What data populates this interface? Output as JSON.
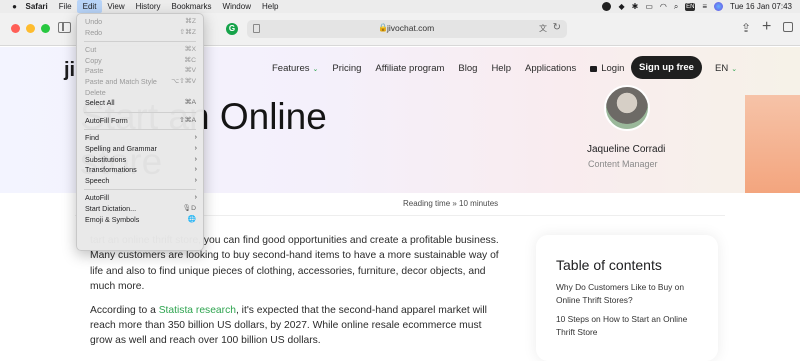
{
  "menubar": {
    "items": [
      "Safari",
      "File",
      "Edit",
      "View",
      "History",
      "Bookmarks",
      "Window",
      "Help"
    ],
    "datetime": "Tue 16 Jan  07:43",
    "badge": "EN"
  },
  "toolbar": {
    "url": "jivochat.com"
  },
  "site": {
    "logo": "ji",
    "nav": [
      "Features",
      "Pricing",
      "Affiliate program",
      "Blog",
      "Help",
      "Applications",
      "Login"
    ],
    "signup_label": "Sign up free",
    "lang": "EN",
    "title_line1": "Start an Online",
    "title_line2": "store",
    "author_name": "Jaqueline Corradi",
    "author_role": "Content Manager",
    "reading_time": "Reading time » 10 minutes",
    "para1": "tart an online thrift store, you can find good opportunities and create a profitable business. Many customers are looking to buy second-hand items to have a more sustainable way of life and also to find unique pieces of clothing, accessories, furniture, decor objects, and much more.",
    "para2_pre": "According to a ",
    "para2_link": "Statista research",
    "para2_post": ", it's expected that the second-hand apparel market will reach more than 350 billion US dollars, by 2027. While online resale ecommerce must grow as well and reach over 100 billion US dollars.",
    "toc_title": "Table of contents",
    "toc_items": [
      "Why Do Customers Like to Buy on Online Thrift Stores?",
      "10 Steps on How to Start an Online Thrift Store"
    ]
  },
  "edit_menu": [
    {
      "label": "Undo",
      "shortcut": "⌘Z",
      "enabled": false
    },
    {
      "label": "Redo",
      "shortcut": "⇧⌘Z",
      "enabled": false
    },
    {
      "sep": true
    },
    {
      "label": "Cut",
      "shortcut": "⌘X",
      "enabled": false
    },
    {
      "label": "Copy",
      "shortcut": "⌘C",
      "enabled": false
    },
    {
      "label": "Paste",
      "shortcut": "⌘V",
      "enabled": false
    },
    {
      "label": "Paste and Match Style",
      "shortcut": "⌥⇧⌘V",
      "enabled": false
    },
    {
      "label": "Delete",
      "shortcut": "",
      "enabled": false
    },
    {
      "label": "Select All",
      "shortcut": "⌘A",
      "enabled": true
    },
    {
      "sep": true
    },
    {
      "label": "AutoFill Form",
      "shortcut": "⇧⌘A",
      "enabled": true
    },
    {
      "sep": true
    },
    {
      "label": "Find",
      "submenu": true,
      "enabled": true
    },
    {
      "label": "Spelling and Grammar",
      "submenu": true,
      "enabled": true
    },
    {
      "label": "Substitutions",
      "submenu": true,
      "enabled": true
    },
    {
      "label": "Transformations",
      "submenu": true,
      "enabled": true
    },
    {
      "label": "Speech",
      "submenu": true,
      "enabled": true
    },
    {
      "sep": true
    },
    {
      "label": "AutoFill",
      "submenu": true,
      "enabled": true
    },
    {
      "label": "Start Dictation...",
      "shortcut": "🎙D",
      "enabled": true
    },
    {
      "label": "Emoji & Symbols",
      "shortcut": "🌐",
      "enabled": true
    }
  ]
}
